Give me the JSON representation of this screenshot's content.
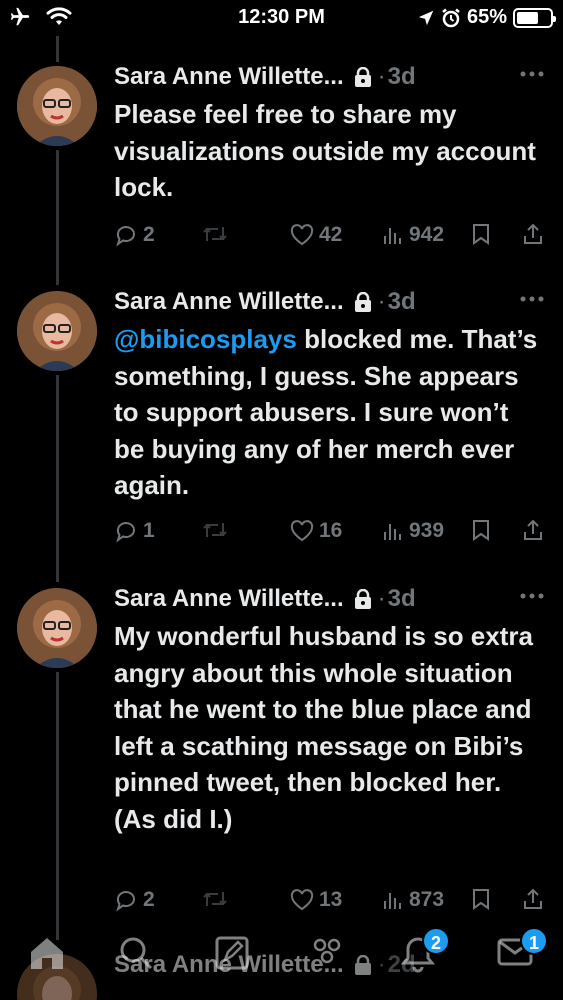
{
  "status_bar": {
    "time": "12:30 PM",
    "battery_percent": "65%",
    "battery_level": 0.65
  },
  "tweets": [
    {
      "author": "Sara Anne Willette...",
      "time": "3d",
      "text_plain": "Please feel free to share my visualizations outside my account lock.",
      "replies": "2",
      "likes": "42",
      "views": "942"
    },
    {
      "author": "Sara Anne Willette...",
      "time": "3d",
      "mention": "@bibicosplays",
      "text_plain": " blocked me. That’s something, I guess. She appears to support abusers. I sure won’t be buying any of her merch ever again.",
      "replies": "1",
      "likes": "16",
      "views": "939"
    },
    {
      "author": "Sara Anne Willette...",
      "time": "3d",
      "text_plain": "My wonderful husband is so extra angry about this whole situation that he went to the blue place and left a scathing message on Bibi’s pinned tweet, then blocked her. (As did I.)",
      "replies": "2",
      "likes": "13",
      "views": "873"
    },
    {
      "author": "Sara Anne Willette...",
      "time": "2d"
    }
  ],
  "nav": {
    "notifications_badge": "2",
    "messages_badge": "1"
  },
  "colors": {
    "background": "#000000",
    "text": "#e7e9ea",
    "muted": "#71767b",
    "accent": "#1d9bf0"
  },
  "icons": [
    "airplane-icon",
    "wifi-icon",
    "location-icon",
    "alarm-icon",
    "lock-icon",
    "more-icon",
    "reply-icon",
    "retweet-icon",
    "like-icon",
    "views-icon",
    "bookmark-icon",
    "share-icon",
    "home-icon",
    "search-icon",
    "compose-icon",
    "communities-icon",
    "notifications-icon",
    "messages-icon"
  ]
}
